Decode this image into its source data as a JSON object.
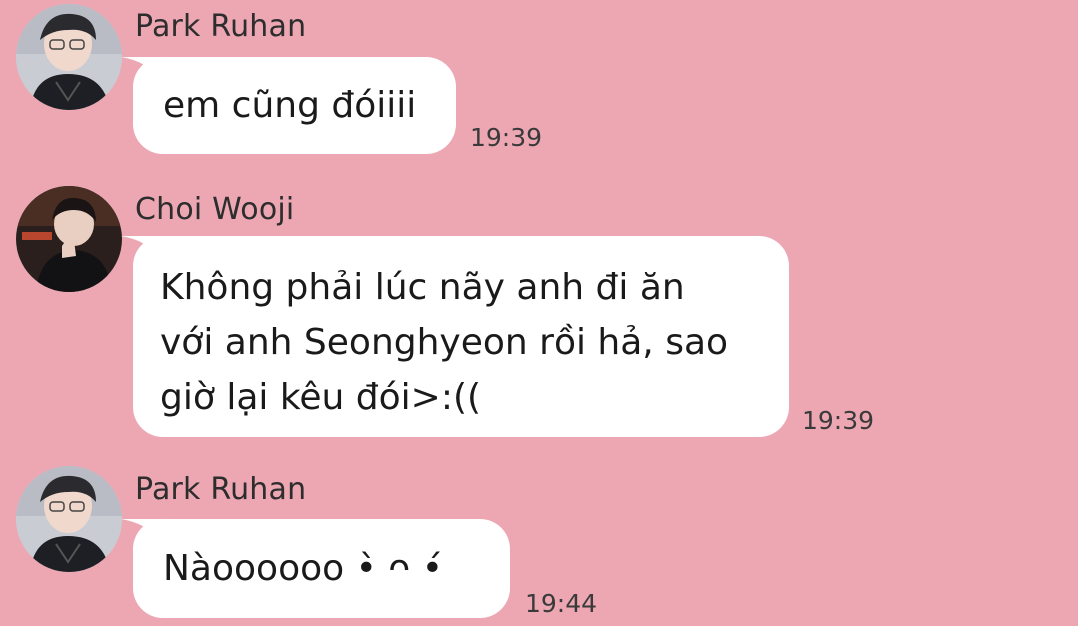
{
  "messages": [
    {
      "sender": "Park Ruhan",
      "avatar": "park-ruhan-avatar",
      "text": "em cũng đóiiii",
      "time": "19:39"
    },
    {
      "sender": "Choi Wooji",
      "avatar": "choi-wooji-avatar",
      "text": "Không phải lúc nãy anh đi ăn\nvới anh Seonghyeon rồi hả, sao\ngiờ lại kêu đói>:((",
      "time": "19:39"
    },
    {
      "sender": "Park Ruhan",
      "avatar": "park-ruhan-avatar",
      "text": "Nàoooooo •̀ ᴖ •́",
      "time": "19:44"
    }
  ],
  "colors": {
    "background": "#eca7b3",
    "bubble": "#ffffff",
    "text": "#1a1a1a"
  }
}
